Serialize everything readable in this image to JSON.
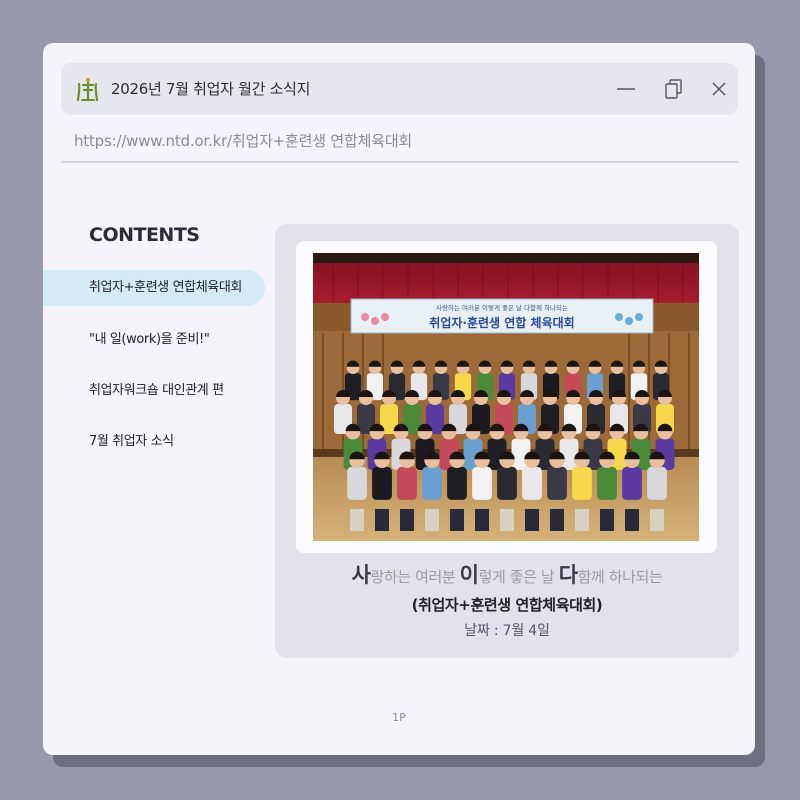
{
  "window": {
    "title": "2026년 7월 취업자 월간 소식지",
    "url": "https://www.ntd.or.kr/취업자+훈련생 연합체육대회",
    "icon": "logo-icon",
    "controls": [
      "minimize-icon",
      "restore-icon",
      "close-icon"
    ]
  },
  "sidebar": {
    "title": "CONTENTS",
    "items": [
      {
        "label": "취업자+훈련생 연합체육대회",
        "active": true
      },
      {
        "label": "\"내 일(work)을 준비!\"",
        "active": false
      },
      {
        "label": "취업자워크숍 대인관계 편",
        "active": false
      },
      {
        "label": "7월 취업자 소식",
        "active": false
      }
    ]
  },
  "article": {
    "banner": {
      "small": "사랑하는 여러분 이렇게 좋은 날 다함께 하나되는",
      "main": "취업자·훈련생 연합 체육대회"
    },
    "caption": {
      "line1": [
        {
          "text": "사",
          "big": true
        },
        {
          "text": "랑하는 여러분 ",
          "big": false
        },
        {
          "text": "이",
          "big": true
        },
        {
          "text": "렇게 좋은 날 ",
          "big": false
        },
        {
          "text": "다",
          "big": true
        },
        {
          "text": "함께 하나되는",
          "big": false
        }
      ],
      "line2": "(취업자+훈련생 연합체육대회)",
      "line3": "날짜 : 7월 4일"
    }
  },
  "footer": {
    "page": "1P"
  },
  "colors": {
    "background": "#9798aa",
    "window": "#f4f4fa",
    "titlebar": "#e6e6ee",
    "active_nav": "#d4ebf4",
    "panel": "#e2e3ea",
    "logo_green": "#6a8f2c"
  }
}
